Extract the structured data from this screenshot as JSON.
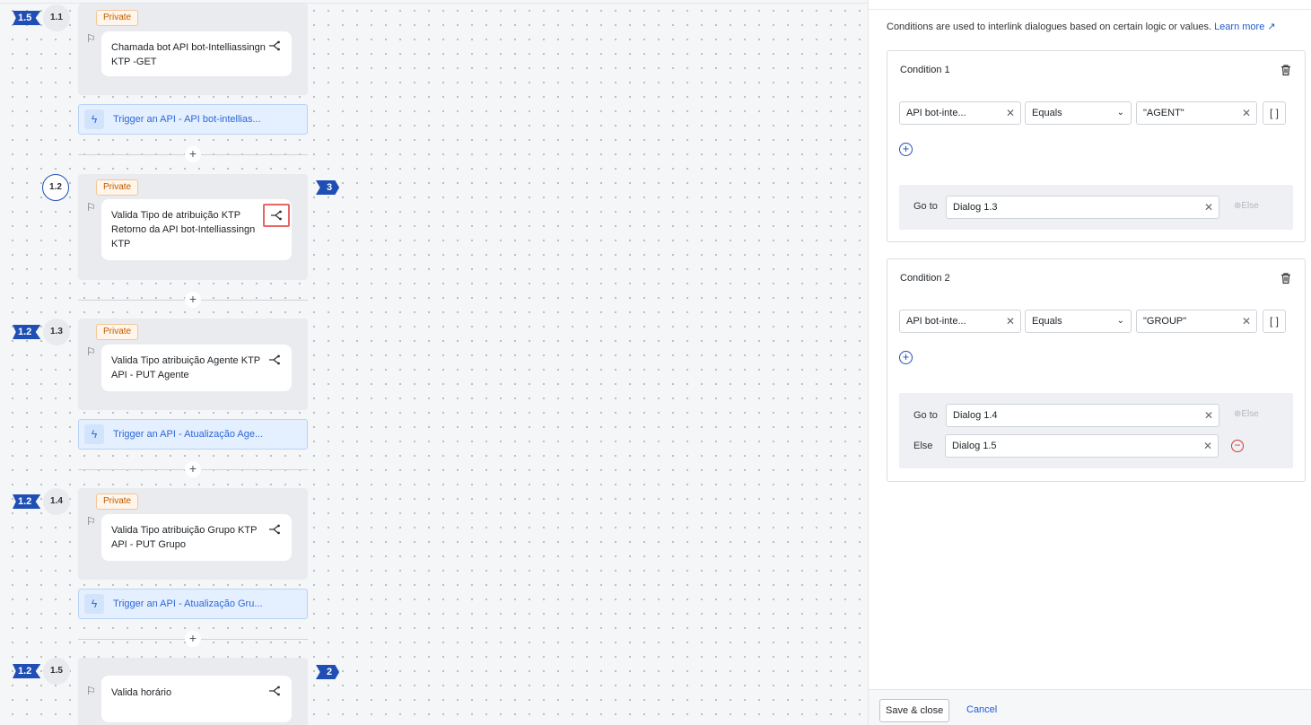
{
  "canvas": {
    "dialogs": [
      {
        "id": "1.1",
        "in_badge": "1.5",
        "out_badge": "",
        "private": "Private",
        "text": "Chamada bot API bot-Intelliassingn KTP -GET",
        "trigger": "Trigger an API - API bot-intellias..."
      },
      {
        "id": "1.2",
        "in_badge": "",
        "out_badge": "3",
        "private": "Private",
        "text": "Valida Tipo de atribuição KTP Retorno da API bot-Intelliassingn KTP",
        "trigger": ""
      },
      {
        "id": "1.3",
        "in_badge": "1.2",
        "out_badge": "",
        "private": "Private",
        "text": "Valida Tipo atribuição Agente KTP API - PUT Agente",
        "trigger": "Trigger an API - Atualização Age..."
      },
      {
        "id": "1.4",
        "in_badge": "1.2",
        "out_badge": "",
        "private": "Private",
        "text": "Valida Tipo atribuição Grupo KTP API - PUT Grupo",
        "trigger": "Trigger an API - Atualização Gru..."
      },
      {
        "id": "1.5",
        "in_badge": "1.2",
        "out_badge": "2",
        "private": "",
        "text": "Valida horário",
        "trigger": ""
      }
    ],
    "plus_label": "+"
  },
  "panel": {
    "intro": "Conditions are used to interlink dialogues based on certain logic or values.",
    "learn_more": "Learn more",
    "conditions": [
      {
        "title": "Condition 1",
        "variable": "API bot-inte...",
        "operator": "Equals",
        "value": "\"AGENT\"",
        "go_to_label": "Go to",
        "go_to": "Dialog 1.3",
        "else_button": "Else",
        "else_label": "",
        "else_value": ""
      },
      {
        "title": "Condition 2",
        "variable": "API bot-inte...",
        "operator": "Equals",
        "value": "\"GROUP\"",
        "go_to_label": "Go to",
        "go_to": "Dialog 1.4",
        "else_button": "Else",
        "else_label": "Else",
        "else_value": "Dialog 1.5"
      }
    ],
    "bracket_label": "[ ]",
    "save_label": "Save & close",
    "cancel_label": "Cancel"
  },
  "colors": {
    "accent": "#1f4fb5",
    "link": "#1f5bd0",
    "private": "#c25b00",
    "highlight": "#e86666",
    "danger": "#d23b3b"
  },
  "icons": [
    "flag-icon",
    "branch-icon",
    "lightning-icon",
    "plus-icon",
    "trash-icon",
    "external-link-icon",
    "close-icon",
    "chevron-down-icon",
    "add-circle-icon",
    "minus-circle-icon"
  ]
}
